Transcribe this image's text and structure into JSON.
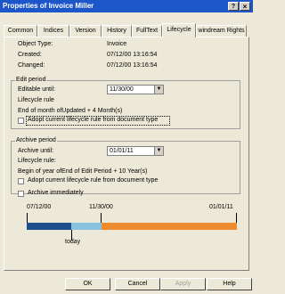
{
  "window": {
    "title": "Properties of Invoice Miller"
  },
  "title_buttons": {
    "help": "?",
    "close": "×"
  },
  "tabs": [
    "Common",
    "Indices",
    "Version",
    "History",
    "FullText",
    "Lifecycle",
    "windream Rights"
  ],
  "info": {
    "object_type_label": "Object Type:",
    "object_type_value": "Invoice",
    "created_label": "Created:",
    "created_value": "07/12/00 13:16:54",
    "changed_label": "Changed:",
    "changed_value": "07/12/00 13:16:54"
  },
  "edit_period": {
    "title": "Edit period",
    "editable_until_label": "Editable until:",
    "editable_until_value": "11/30/00",
    "rule_label": "Lifecycle rule",
    "rule_text": "End of month ofUpdated + 4 Month(s)",
    "adopt_label": "Adopt current lifecycle rule from document type",
    "adopt_checked": false
  },
  "archive_period": {
    "title": "Archive period",
    "archive_until_label": "Archive until:",
    "archive_until_value": "01/01/11",
    "rule_label": "Lifecycle rule:",
    "rule_text": "Begin of year ofEnd of Edit Period + 10 Year(s)",
    "adopt_label": "Adopt current lifecycle rule from document type",
    "adopt_checked": false
  },
  "archive_immediately": {
    "label": "Archive immediately",
    "checked": false
  },
  "timeline": {
    "start_label": "07/12/00",
    "mid_label": "11/30/00",
    "end_label": "01/01/11",
    "today_label": "today",
    "colors": {
      "past": "#1f4e8c",
      "edit": "#87c3e0",
      "archive": "#ef8a2f"
    }
  },
  "buttons": {
    "ok": "OK",
    "cancel": "Cancel",
    "apply": "Apply",
    "help": "Help"
  }
}
